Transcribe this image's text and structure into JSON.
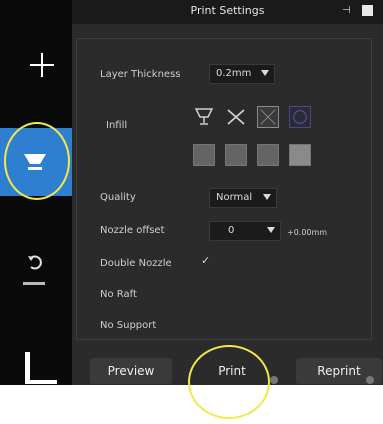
{
  "window": {
    "title": "Print Settings"
  },
  "sidebar": {
    "items": [
      {
        "name": "add",
        "icon": "plus-icon"
      },
      {
        "name": "print-settings",
        "icon": "cup-print-icon",
        "active": true
      },
      {
        "name": "undo",
        "icon": "undo-icon"
      },
      {
        "name": "level",
        "icon": "corner-icon"
      }
    ],
    "accent": "#2f7fd1"
  },
  "settings": {
    "layer_thickness": {
      "label": "Layer Thickness",
      "value": "0.2mm"
    },
    "infill": {
      "label": "Infill"
    },
    "quality": {
      "label": "Quality",
      "value": "Normal"
    },
    "nozzle_offset": {
      "label": "Nozzle offset",
      "value": "0",
      "extra": "+0.00mm"
    },
    "double_nozzle": {
      "label": "Double Nozzle",
      "checked": true
    },
    "no_raft": {
      "label": "No Raft"
    },
    "no_support": {
      "label": "No Support"
    }
  },
  "buttons": {
    "preview": "Preview",
    "print": "Print",
    "reprint": "Reprint"
  },
  "highlight_color": "#f2e84a"
}
